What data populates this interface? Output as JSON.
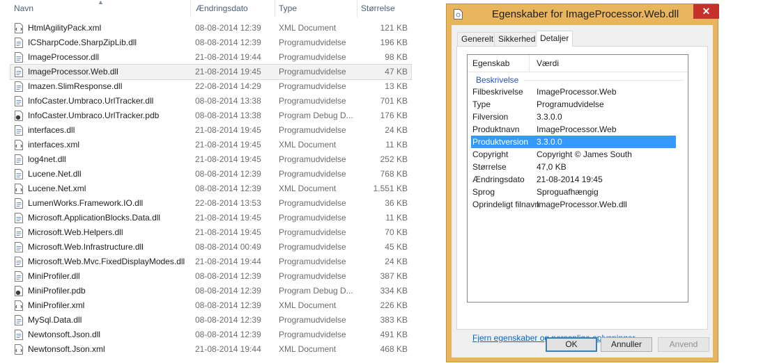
{
  "explorer": {
    "columns": {
      "name": "Navn",
      "date": "Ændringsdato",
      "type": "Type",
      "size": "Størrelse"
    },
    "files": [
      {
        "name": "HtmlAgilityPack.xml",
        "date": "08-08-2014 12:39",
        "type": "XML Document",
        "size": "121 KB",
        "icon": "xml-document-icon"
      },
      {
        "name": "ICSharpCode.SharpZipLib.dll",
        "date": "08-08-2014 12:39",
        "type": "Programudvidelse",
        "size": "196 KB",
        "icon": "dll-file-icon"
      },
      {
        "name": "ImageProcessor.dll",
        "date": "21-08-2014 19:44",
        "type": "Programudvidelse",
        "size": "98 KB",
        "icon": "dll-file-icon"
      },
      {
        "name": "ImageProcessor.Web.dll",
        "date": "21-08-2014 19:45",
        "type": "Programudvidelse",
        "size": "47 KB",
        "icon": "dll-file-icon",
        "selected": true
      },
      {
        "name": "Imazen.SlimResponse.dll",
        "date": "22-08-2014 14:29",
        "type": "Programudvidelse",
        "size": "13 KB",
        "icon": "dll-file-icon"
      },
      {
        "name": "InfoCaster.Umbraco.UrlTracker.dll",
        "date": "08-08-2014 13:38",
        "type": "Programudvidelse",
        "size": "701 KB",
        "icon": "dll-file-icon"
      },
      {
        "name": "InfoCaster.Umbraco.UrlTracker.pdb",
        "date": "08-08-2014 13:38",
        "type": "Program Debug D...",
        "size": "176 KB",
        "icon": "pdb-file-icon"
      },
      {
        "name": "interfaces.dll",
        "date": "21-08-2014 19:45",
        "type": "Programudvidelse",
        "size": "24 KB",
        "icon": "dll-file-icon"
      },
      {
        "name": "interfaces.xml",
        "date": "21-08-2014 19:45",
        "type": "XML Document",
        "size": "11 KB",
        "icon": "xml-document-icon"
      },
      {
        "name": "log4net.dll",
        "date": "21-08-2014 19:45",
        "type": "Programudvidelse",
        "size": "252 KB",
        "icon": "dll-file-icon"
      },
      {
        "name": "Lucene.Net.dll",
        "date": "08-08-2014 12:39",
        "type": "Programudvidelse",
        "size": "768 KB",
        "icon": "dll-file-icon"
      },
      {
        "name": "Lucene.Net.xml",
        "date": "08-08-2014 12:39",
        "type": "XML Document",
        "size": "1.551 KB",
        "icon": "xml-document-icon"
      },
      {
        "name": "LumenWorks.Framework.IO.dll",
        "date": "22-08-2014 13:53",
        "type": "Programudvidelse",
        "size": "36 KB",
        "icon": "dll-file-icon"
      },
      {
        "name": "Microsoft.ApplicationBlocks.Data.dll",
        "date": "21-08-2014 19:45",
        "type": "Programudvidelse",
        "size": "11 KB",
        "icon": "dll-file-icon"
      },
      {
        "name": "Microsoft.Web.Helpers.dll",
        "date": "21-08-2014 19:45",
        "type": "Programudvidelse",
        "size": "70 KB",
        "icon": "dll-file-icon"
      },
      {
        "name": "Microsoft.Web.Infrastructure.dll",
        "date": "08-08-2014 00:49",
        "type": "Programudvidelse",
        "size": "45 KB",
        "icon": "dll-file-icon"
      },
      {
        "name": "Microsoft.Web.Mvc.FixedDisplayModes.dll",
        "date": "21-08-2014 19:44",
        "type": "Programudvidelse",
        "size": "24 KB",
        "icon": "dll-file-icon"
      },
      {
        "name": "MiniProfiler.dll",
        "date": "08-08-2014 12:39",
        "type": "Programudvidelse",
        "size": "387 KB",
        "icon": "dll-file-icon"
      },
      {
        "name": "MiniProfiler.pdb",
        "date": "08-08-2014 12:39",
        "type": "Program Debug D...",
        "size": "334 KB",
        "icon": "pdb-file-icon"
      },
      {
        "name": "MiniProfiler.xml",
        "date": "08-08-2014 12:39",
        "type": "XML Document",
        "size": "226 KB",
        "icon": "xml-document-icon"
      },
      {
        "name": "MySql.Data.dll",
        "date": "08-08-2014 12:39",
        "type": "Programudvidelse",
        "size": "383 KB",
        "icon": "dll-file-icon"
      },
      {
        "name": "Newtonsoft.Json.dll",
        "date": "08-08-2014 12:39",
        "type": "Programudvidelse",
        "size": "491 KB",
        "icon": "dll-file-icon"
      },
      {
        "name": "Newtonsoft.Json.xml",
        "date": "21-08-2014 19:44",
        "type": "XML Document",
        "size": "468 KB",
        "icon": "xml-document-icon"
      }
    ]
  },
  "dialog": {
    "title": "Egenskaber for ImageProcessor.Web.dll",
    "close_glyph": "✕",
    "tabs": [
      {
        "label": "Generelt",
        "active": false
      },
      {
        "label": "Sikkerhed",
        "active": false
      },
      {
        "label": "Detaljer",
        "active": true
      }
    ],
    "headers": {
      "property": "Egenskab",
      "value": "Værdi"
    },
    "group_label": "Beskrivelse",
    "properties": [
      {
        "name": "Filbeskrivelse",
        "value": "ImageProcessor.Web"
      },
      {
        "name": "Type",
        "value": "Programudvidelse"
      },
      {
        "name": "Filversion",
        "value": "3.3.0.0"
      },
      {
        "name": "Produktnavn",
        "value": "ImageProcessor.Web"
      },
      {
        "name": "Produktversion",
        "value": "3.3.0.0",
        "selected": true
      },
      {
        "name": "Copyright",
        "value": "Copyright © James South"
      },
      {
        "name": "Størrelse",
        "value": "47,0 KB"
      },
      {
        "name": "Ændringsdato",
        "value": "21-08-2014 19:45"
      },
      {
        "name": "Sprog",
        "value": "Sproguafhængig"
      },
      {
        "name": "Oprindeligt filnavn",
        "value": "ImageProcessor.Web.dll"
      }
    ],
    "remove_link": "Fjern egenskaber og personlige oplysninger",
    "buttons": {
      "ok": "OK",
      "cancel": "Annuller",
      "apply": "Anvend"
    }
  },
  "colors": {
    "title_bar": "#e8b45c",
    "close_button": "#c7312b",
    "selection": "#3399ff",
    "link": "#0066cc",
    "group_label": "#2a52be"
  }
}
